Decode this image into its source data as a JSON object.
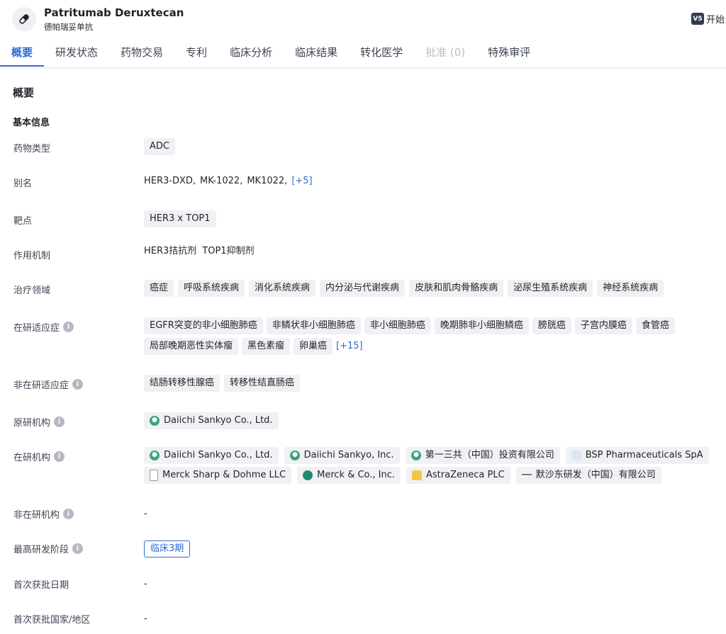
{
  "drug": {
    "name": "Patritumab Deruxtecan",
    "name_cn": "德帕瑞妥单抗"
  },
  "header_right": {
    "badge": "V5",
    "start": "开始"
  },
  "tabs": [
    {
      "label": "概要"
    },
    {
      "label": "研发状态"
    },
    {
      "label": "药物交易"
    },
    {
      "label": "专利"
    },
    {
      "label": "临床分析"
    },
    {
      "label": "临床结果"
    },
    {
      "label": "转化医学"
    },
    {
      "label": "批准 (0)"
    },
    {
      "label": "特殊审评"
    }
  ],
  "section_title": "概要",
  "sub_title": "基本信息",
  "fields": {
    "drug_type": {
      "label": "药物类型",
      "tags": [
        "ADC"
      ]
    },
    "alias": {
      "label": "别名",
      "items": [
        "HER3-DXD,",
        "MK-1022,",
        "MK1022,"
      ],
      "more": "[+5]"
    },
    "target": {
      "label": "靶点",
      "tags": [
        "HER3 x TOP1"
      ]
    },
    "mechanism": {
      "label": "作用机制",
      "items": [
        "HER3拮抗剂",
        "TOP1抑制剂"
      ]
    },
    "therapeutic_area": {
      "label": "治疗领域",
      "tags": [
        "癌症",
        "呼吸系统疾病",
        "消化系统疾病",
        "内分泌与代谢疾病",
        "皮肤和肌肉骨骼疾病",
        "泌尿生殖系统疾病",
        "神经系统疾病"
      ]
    },
    "active_indications": {
      "label": "在研适应症",
      "tags": [
        "EGFR突变的非小细胞肺癌",
        "非鳞状非小细胞肺癌",
        "非小细胞肺癌",
        "晚期肺非小细胞鳞癌",
        "膀胱癌",
        "子宫内膜癌",
        "食管癌",
        "局部晚期恶性实体瘤",
        "黑色素瘤",
        "卵巢癌"
      ],
      "more": "[+15]"
    },
    "inactive_indications": {
      "label": "非在研适应症",
      "tags": [
        "结肠转移性腺癌",
        "转移性结直肠癌"
      ]
    },
    "originator": {
      "label": "原研机构",
      "orgs": [
        {
          "name": "Daiichi Sankyo Co., Ltd.",
          "color": "#3aa57a"
        }
      ]
    },
    "active_orgs": {
      "label": "在研机构",
      "orgs": [
        {
          "name": "Daiichi Sankyo Co., Ltd.",
          "color": "#3aa57a"
        },
        {
          "name": "Daiichi Sankyo, Inc.",
          "color": "#3aa57a"
        },
        {
          "name": "第一三共（中国）投资有限公司",
          "color": "#3aa57a"
        },
        {
          "name": "BSP Pharmaceuticals SpA",
          "color": "#5b7fb0"
        },
        {
          "name": "Merck Sharp & Dohme LLC",
          "color": "#888888"
        },
        {
          "name": "Merck & Co., Inc.",
          "color": "#1f8a70"
        },
        {
          "name": "AstraZeneca PLC",
          "color": "#e0a100"
        },
        {
          "name": "默沙东研发（中国）有限公司",
          "color": "#888888"
        }
      ]
    },
    "inactive_orgs": {
      "label": "非在研机构",
      "value": "-"
    },
    "highest_phase": {
      "label": "最高研发阶段",
      "value": "临床3期"
    },
    "first_approval_date": {
      "label": "首次获批日期",
      "value": "-"
    },
    "first_approval_region": {
      "label": "首次获批国家/地区",
      "value": "-"
    }
  }
}
